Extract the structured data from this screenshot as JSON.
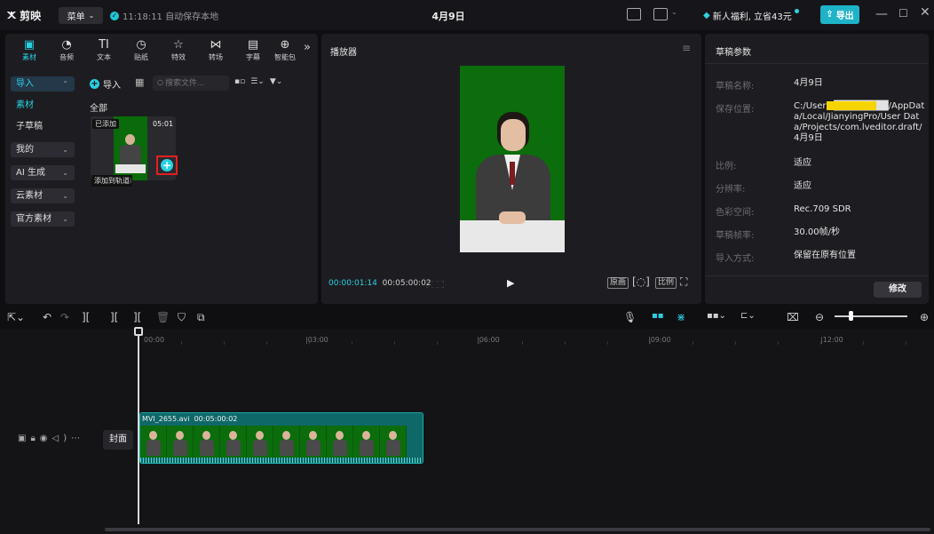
{
  "titlebar": {
    "logo_text": "剪映",
    "menu_label": "菜单",
    "autosave_text": "11:18:11 自动保存本地",
    "project_title": "4月9日",
    "promo_text": "新人福利, 立省43元",
    "export_label": "导出"
  },
  "tool_tabs": [
    {
      "label": "素材",
      "icon": "media-icon",
      "glyph": "▣"
    },
    {
      "label": "音频",
      "icon": "audio-icon",
      "glyph": "◔"
    },
    {
      "label": "文本",
      "icon": "text-icon",
      "glyph": "TI"
    },
    {
      "label": "贴纸",
      "icon": "sticker-icon",
      "glyph": "◷"
    },
    {
      "label": "特效",
      "icon": "effects-icon",
      "glyph": "☆"
    },
    {
      "label": "转场",
      "icon": "transition-icon",
      "glyph": "⋈"
    },
    {
      "label": "字幕",
      "icon": "subtitle-icon",
      "glyph": "▤"
    },
    {
      "label": "智能包",
      "icon": "smart-pack-icon",
      "glyph": "⊕"
    }
  ],
  "sidebar": {
    "items": [
      {
        "label": "导入"
      },
      {
        "label": "素材"
      },
      {
        "label": "子草稿"
      },
      {
        "label": "我的"
      },
      {
        "label": "AI 生成"
      },
      {
        "label": "云素材"
      },
      {
        "label": "官方素材"
      }
    ]
  },
  "media": {
    "import_label": "导入",
    "search_placeholder": "搜索文件...",
    "all_label": "全部",
    "item": {
      "badge": "已添加",
      "duration": "05:01",
      "tooltip": "添加到轨道",
      "name_fragment": "i"
    }
  },
  "player": {
    "label": "播放器",
    "current_time": "00:00:01:14",
    "total_time": "00:05:00:02",
    "ctrl_original": "原画",
    "ctrl_ratio": "比例"
  },
  "props": {
    "title": "草稿参数",
    "rows": [
      {
        "label": "草稿名称:",
        "value": "4月9日"
      },
      {
        "label": "保存位置:",
        "value": "C:/Users/████████/AppData/Local/JianyingPro/User Data/Projects/com.lveditor.draft/4月9日"
      },
      {
        "label": "比例:",
        "value": "适应"
      },
      {
        "label": "分辨率:",
        "value": "适应"
      },
      {
        "label": "色彩空间:",
        "value": "Rec.709 SDR"
      },
      {
        "label": "草稿帧率:",
        "value": "30.00帧/秒"
      },
      {
        "label": "导入方式:",
        "value": "保留在原有位置"
      }
    ],
    "modify_label": "修改"
  },
  "timeline": {
    "ruler_labels": [
      "00:00",
      "|03:00",
      "|06:00",
      "|09:00",
      "|12:00"
    ],
    "cover_label": "封面",
    "clip_name": "MVI_2655.avi",
    "clip_duration": "00:05:00:02"
  },
  "colors": {
    "accent": "#2ad0e2",
    "highlight": "#e02020",
    "green_screen": "#0b6d0b"
  }
}
